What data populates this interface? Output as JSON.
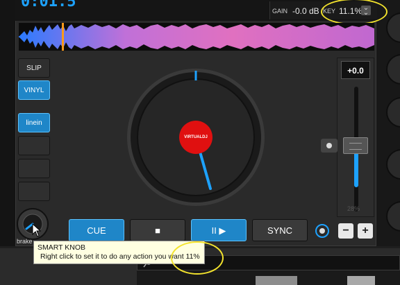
{
  "deck": {
    "time": "0:01.5",
    "gain_label": "GAIN",
    "gain_value": "-0.0 dB",
    "key_label": "KEY",
    "key_value": "11.1%",
    "key_arrow": "chevron-down-icon"
  },
  "side_buttons": {
    "slip": "SLIP",
    "vinyl": "VINYL",
    "linein": "linein"
  },
  "jog": {
    "logo_text": "VIRTUALDJ"
  },
  "knob": {
    "label": "brake"
  },
  "pitch": {
    "value": "+0.0",
    "range": "28%"
  },
  "transport": {
    "cue": "CUE",
    "stop": "■",
    "play": "II ▶",
    "sync": "SYNC"
  },
  "pitch_buttons": {
    "minus": "−",
    "plus": "+"
  },
  "tooltip": {
    "title": "SMART KNOB",
    "text": "Right click to set it to do any action you want 11%"
  },
  "colors": {
    "accent": "#1da2ff",
    "highlight_ring": "#f3e32d",
    "jog_center": "#e01010"
  }
}
